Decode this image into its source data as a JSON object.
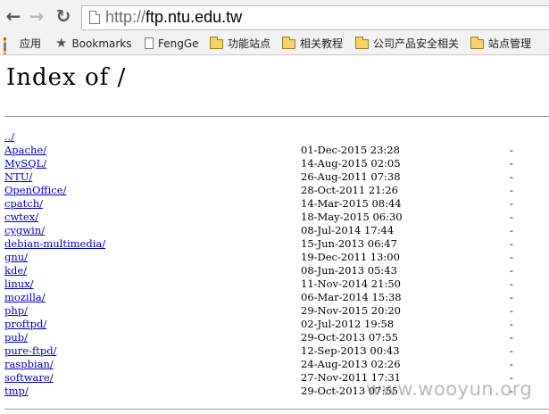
{
  "browser": {
    "back_glyph": "←",
    "forward_glyph": "→",
    "reload_glyph": "↻",
    "url_scheme": "http://",
    "url_host": "ftp.ntu.edu.tw"
  },
  "bookmarks": {
    "items": [
      {
        "label": "应用",
        "icon": "apps-grid-icon"
      },
      {
        "label": "Bookmarks",
        "icon": "star-icon"
      },
      {
        "label": "FengGe",
        "icon": "page-icon"
      },
      {
        "label": "功能站点",
        "icon": "folder-icon"
      },
      {
        "label": "相关教程",
        "icon": "folder-icon"
      },
      {
        "label": "公司产品安全相关",
        "icon": "folder-icon"
      },
      {
        "label": "站点管理",
        "icon": "folder-icon"
      }
    ],
    "apps_colors": [
      "#ea4335",
      "#fbbc05",
      "#34a853",
      "#4285f4",
      "#ea4335",
      "#fbbc05",
      "#34a853",
      "#4285f4",
      "#ea4335"
    ]
  },
  "page": {
    "title": "Index of /",
    "parent_link": "../",
    "entries": [
      {
        "name": "Apache/",
        "date": "01-Dec-2015 23:28",
        "size": "-"
      },
      {
        "name": "MySQL/",
        "date": "14-Aug-2015 02:05",
        "size": "-"
      },
      {
        "name": "NTU/",
        "date": "26-Aug-2011 07:38",
        "size": "-"
      },
      {
        "name": "OpenOffice/",
        "date": "28-Oct-2011 21:26",
        "size": "-"
      },
      {
        "name": "cpatch/",
        "date": "14-Mar-2015 08:44",
        "size": "-"
      },
      {
        "name": "cwtex/",
        "date": "18-May-2015 06:30",
        "size": "-"
      },
      {
        "name": "cygwin/",
        "date": "08-Jul-2014 17:44",
        "size": "-"
      },
      {
        "name": "debian-multimedia/",
        "date": "15-Jun-2013 06:47",
        "size": "-"
      },
      {
        "name": "gnu/",
        "date": "19-Dec-2011 13:00",
        "size": "-"
      },
      {
        "name": "kde/",
        "date": "08-Jun-2013 05:43",
        "size": "-"
      },
      {
        "name": "linux/",
        "date": "11-Nov-2014 21:50",
        "size": "-"
      },
      {
        "name": "mozilla/",
        "date": "06-Mar-2014 15:38",
        "size": "-"
      },
      {
        "name": "php/",
        "date": "29-Nov-2015 20:20",
        "size": "-"
      },
      {
        "name": "proftpd/",
        "date": "02-Jul-2012 19:58",
        "size": "-"
      },
      {
        "name": "pub/",
        "date": "29-Oct-2013 07:55",
        "size": "-"
      },
      {
        "name": "pure-ftpd/",
        "date": "12-Sep-2013 00:43",
        "size": "-"
      },
      {
        "name": "raspbian/",
        "date": "24-Aug-2013 02:26",
        "size": "-"
      },
      {
        "name": "software/",
        "date": "27-Nov-2011 17:31",
        "size": "-"
      },
      {
        "name": "tmp/",
        "date": "29-Oct-2013 07:55",
        "size": "-"
      }
    ]
  },
  "watermark": "www.wooyun.org",
  "colors": {
    "link": "#0000cc",
    "chrome_bg": "#f2f2f2"
  }
}
